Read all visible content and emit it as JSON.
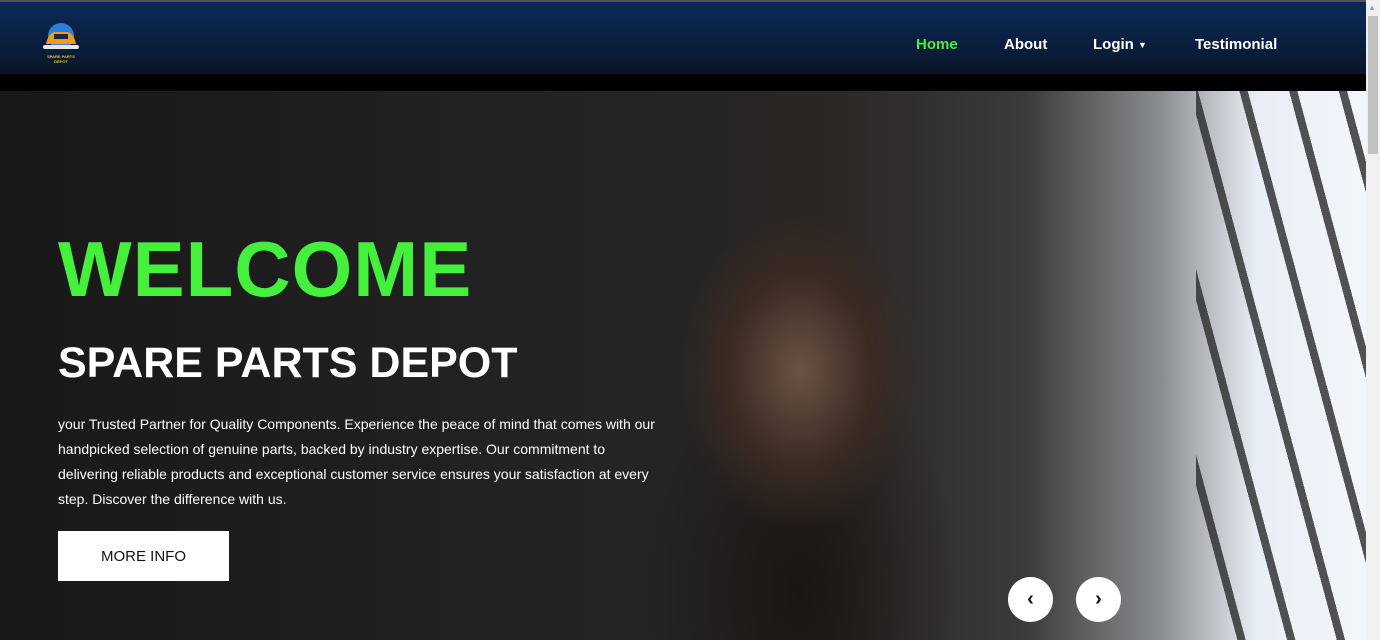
{
  "logo": {
    "text": "SPARE PARTS DEPOT"
  },
  "nav": {
    "items": [
      {
        "label": "Home",
        "active": true
      },
      {
        "label": "About"
      },
      {
        "label": "Login"
      },
      {
        "label": "Testimonial"
      }
    ],
    "active_color": "#44f03c"
  },
  "hero": {
    "welcome": "WELCOME",
    "title": "SPARE PARTS DEPOT",
    "description": "your Trusted Partner for Quality Components. Experience the peace of mind that comes with our handpicked selection of genuine parts, backed by industry expertise. Our commitment to delivering reliable products and exceptional customer service ensures your satisfaction at every step. Discover the difference with us.",
    "button": "MORE INFO",
    "prev": "‹",
    "next": "›"
  }
}
